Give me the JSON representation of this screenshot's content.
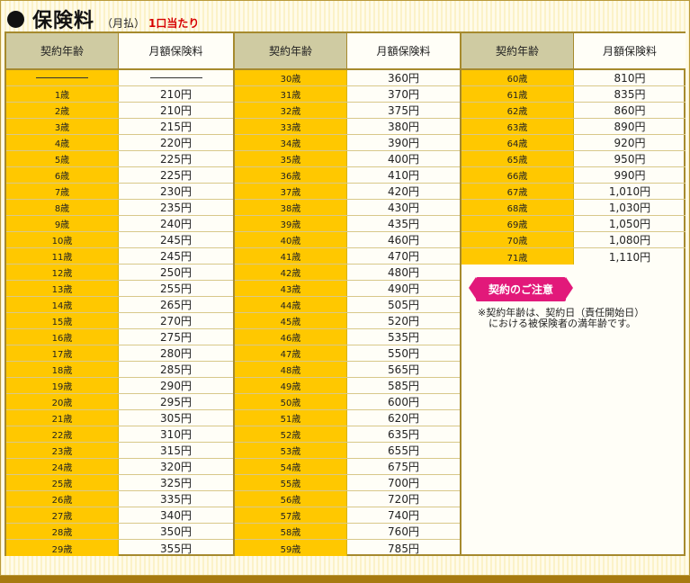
{
  "header": {
    "title": "保険料",
    "sub": "（月払）",
    "sub_red": "1口当たり"
  },
  "table": {
    "age_header": "契約年齢",
    "price_header": "月額保険料",
    "col1": [
      {
        "age": "",
        "price": ""
      },
      {
        "age": "1歳",
        "price": "210円"
      },
      {
        "age": "2歳",
        "price": "210円"
      },
      {
        "age": "3歳",
        "price": "215円"
      },
      {
        "age": "4歳",
        "price": "220円"
      },
      {
        "age": "5歳",
        "price": "225円"
      },
      {
        "age": "6歳",
        "price": "225円"
      },
      {
        "age": "7歳",
        "price": "230円"
      },
      {
        "age": "8歳",
        "price": "235円"
      },
      {
        "age": "9歳",
        "price": "240円"
      },
      {
        "age": "10歳",
        "price": "245円"
      },
      {
        "age": "11歳",
        "price": "245円"
      },
      {
        "age": "12歳",
        "price": "250円"
      },
      {
        "age": "13歳",
        "price": "255円"
      },
      {
        "age": "14歳",
        "price": "265円"
      },
      {
        "age": "15歳",
        "price": "270円"
      },
      {
        "age": "16歳",
        "price": "275円"
      },
      {
        "age": "17歳",
        "price": "280円"
      },
      {
        "age": "18歳",
        "price": "285円"
      },
      {
        "age": "19歳",
        "price": "290円"
      },
      {
        "age": "20歳",
        "price": "295円"
      },
      {
        "age": "21歳",
        "price": "305円"
      },
      {
        "age": "22歳",
        "price": "310円"
      },
      {
        "age": "23歳",
        "price": "315円"
      },
      {
        "age": "24歳",
        "price": "320円"
      },
      {
        "age": "25歳",
        "price": "325円"
      },
      {
        "age": "26歳",
        "price": "335円"
      },
      {
        "age": "27歳",
        "price": "340円"
      },
      {
        "age": "28歳",
        "price": "350円"
      },
      {
        "age": "29歳",
        "price": "355円"
      }
    ],
    "col2": [
      {
        "age": "30歳",
        "price": "360円"
      },
      {
        "age": "31歳",
        "price": "370円"
      },
      {
        "age": "32歳",
        "price": "375円"
      },
      {
        "age": "33歳",
        "price": "380円"
      },
      {
        "age": "34歳",
        "price": "390円"
      },
      {
        "age": "35歳",
        "price": "400円"
      },
      {
        "age": "36歳",
        "price": "410円"
      },
      {
        "age": "37歳",
        "price": "420円"
      },
      {
        "age": "38歳",
        "price": "430円"
      },
      {
        "age": "39歳",
        "price": "435円"
      },
      {
        "age": "40歳",
        "price": "460円"
      },
      {
        "age": "41歳",
        "price": "470円"
      },
      {
        "age": "42歳",
        "price": "480円"
      },
      {
        "age": "43歳",
        "price": "490円"
      },
      {
        "age": "44歳",
        "price": "505円"
      },
      {
        "age": "45歳",
        "price": "520円"
      },
      {
        "age": "46歳",
        "price": "535円"
      },
      {
        "age": "47歳",
        "price": "550円"
      },
      {
        "age": "48歳",
        "price": "565円"
      },
      {
        "age": "49歳",
        "price": "585円"
      },
      {
        "age": "50歳",
        "price": "600円"
      },
      {
        "age": "51歳",
        "price": "620円"
      },
      {
        "age": "52歳",
        "price": "635円"
      },
      {
        "age": "53歳",
        "price": "655円"
      },
      {
        "age": "54歳",
        "price": "675円"
      },
      {
        "age": "55歳",
        "price": "700円"
      },
      {
        "age": "56歳",
        "price": "720円"
      },
      {
        "age": "57歳",
        "price": "740円"
      },
      {
        "age": "58歳",
        "price": "760円"
      },
      {
        "age": "59歳",
        "price": "785円"
      }
    ],
    "col3": [
      {
        "age": "60歳",
        "price": "810円"
      },
      {
        "age": "61歳",
        "price": "835円"
      },
      {
        "age": "62歳",
        "price": "860円"
      },
      {
        "age": "63歳",
        "price": "890円"
      },
      {
        "age": "64歳",
        "price": "920円"
      },
      {
        "age": "65歳",
        "price": "950円"
      },
      {
        "age": "66歳",
        "price": "990円"
      },
      {
        "age": "67歳",
        "price": "1,010円"
      },
      {
        "age": "68歳",
        "price": "1,030円"
      },
      {
        "age": "69歳",
        "price": "1,050円"
      },
      {
        "age": "70歳",
        "price": "1,080円"
      },
      {
        "age": "71歳",
        "price": "1,110円"
      }
    ]
  },
  "notice": {
    "label": "契約のご注意",
    "line1": "※契約年齢は、契約日（責任開始日）",
    "line2": "における被保険者の満年齢です。"
  }
}
